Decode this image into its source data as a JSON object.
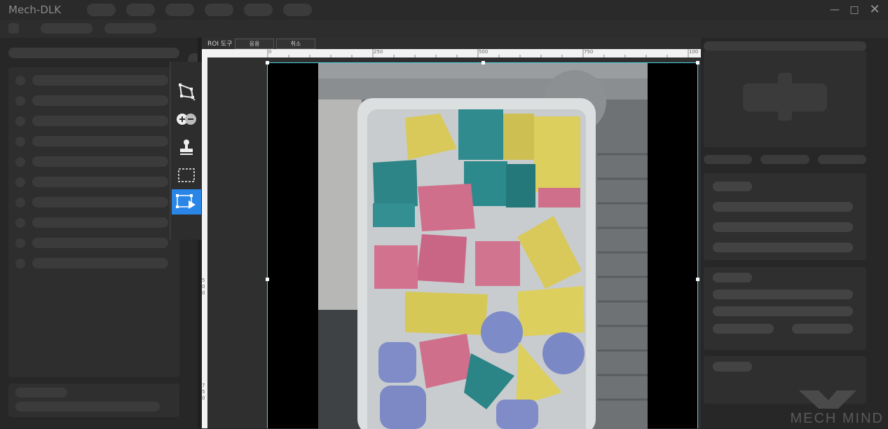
{
  "app": {
    "title": "Mech-DLK"
  },
  "roi_toolbar": {
    "label": "ROI 도구",
    "apply_label": "응용",
    "cancel_label": "취소"
  },
  "ruler": {
    "top_ticks": [
      "0",
      "250",
      "500",
      "750",
      "100"
    ],
    "left_ticks": [
      "5\n0\n0",
      "7\n5\n0"
    ]
  },
  "tools": [
    {
      "name": "polygon-tool-icon",
      "active": false
    },
    {
      "name": "add-remove-icon",
      "active": false
    },
    {
      "name": "stamp-icon",
      "active": false
    },
    {
      "name": "rect-select-icon",
      "active": false
    },
    {
      "name": "roi-play-icon",
      "active": true
    }
  ],
  "watermark": "MECH MIND",
  "colors": {
    "accent": "#2a86e6",
    "roi_border": "#4fd3e6",
    "yellow": "#d8c95a",
    "teal": "#2d8a8c",
    "pink": "#cf6f8b",
    "blue": "#7d8bc9"
  }
}
